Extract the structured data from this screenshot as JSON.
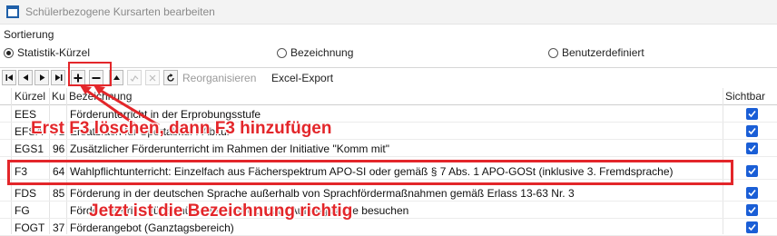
{
  "window": {
    "title": "Schülerbezogene Kursarten bearbeiten"
  },
  "sort": {
    "label": "Sortierung",
    "options": [
      "Statistik-Kürzel",
      "Bezeichnung",
      "Benutzerdefiniert"
    ],
    "selected": "Statistik-Kürzel"
  },
  "toolbar": {
    "buttons": [
      "first-record",
      "previous-record",
      "next-record",
      "last-record",
      "insert-record",
      "delete-record",
      "edit-record",
      "post-edit",
      "cancel-edit",
      "refresh-data"
    ],
    "reorganize_label": "Reorganisieren",
    "excel_export_label": "Excel-Export"
  },
  "table": {
    "headers": {
      "kuerzel": "Kürzel",
      "ku": "Ku",
      "bezeichnung": "Bezeichnung",
      "sichtbar": "Sichtbar"
    },
    "rows": [
      {
        "kuerzel": "EES",
        "ku": "",
        "bezeichnung": "Förderunterricht in der Erprobungsstufe",
        "sichtbar": true
      },
      {
        "kuerzel": "EFSA",
        "ku": "71",
        "bezeichnung": "Ersatzfach für Sportabitur / Abitur",
        "sichtbar": true
      },
      {
        "kuerzel": "EGS1",
        "ku": "96",
        "bezeichnung": "Zusätzlicher Förderunterricht im Rahmen der Initiative \"Komm mit\"",
        "sichtbar": true
      },
      {
        "kuerzel": "F3",
        "ku": "64",
        "bezeichnung": "Wahlpflichtunterricht: Einzelfach aus Fächerspektrum APO-SI oder gemäß § 7 Abs. 1 APO-GOSt (inklusive 3. Fremdsprache)",
        "sichtbar": true
      },
      {
        "kuerzel": "FDS",
        "ku": "85",
        "bezeichnung": "Förderung in der deutschen Sprache außerhalb von Sprachfördermaßnahmen gemäß Erlass 13-63 Nr. 3",
        "sichtbar": true
      },
      {
        "kuerzel": "FG",
        "ku": "",
        "bezeichnung": "Förderunterricht für Schüler der Vorber.- bzw. Auffangklasse besuchen",
        "sichtbar": true
      },
      {
        "kuerzel": "FOGT",
        "ku": "37",
        "bezeichnung": "Förderangebot (Ganztagsbereich)",
        "sichtbar": true
      }
    ]
  },
  "annotations": {
    "top": "Erst F3 löschen, dann F3 hinzufügen",
    "bottom": "Jetzt ist die Bezeichnung richtig",
    "color": "#e3262a"
  },
  "colors": {
    "checkbox": "#1a5ed6",
    "annotation": "#e3262a"
  }
}
